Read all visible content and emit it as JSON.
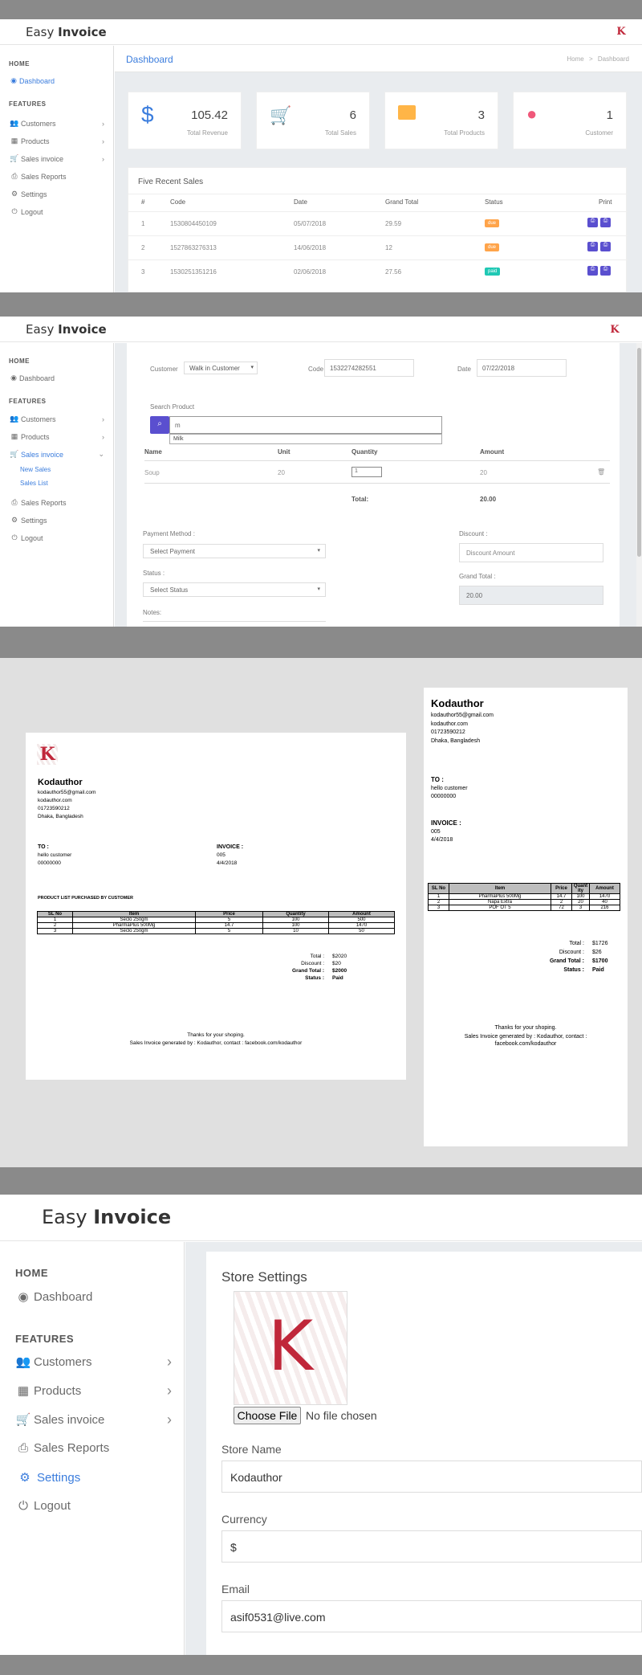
{
  "app": {
    "logo_plain": "Easy ",
    "logo_bold": "Invoice",
    "avatar_letter": "K"
  },
  "sidebar": {
    "home_heading": "HOME",
    "features_heading": "FEATURES",
    "items": [
      {
        "label": "Dashboard",
        "icon": "dashboard-icon"
      },
      {
        "label": "Customers",
        "icon": "customers-icon"
      },
      {
        "label": "Products",
        "icon": "products-icon"
      },
      {
        "label": "Sales invoice",
        "icon": "cart-icon"
      },
      {
        "label": "Sales Reports",
        "icon": "printer-icon"
      },
      {
        "label": "Settings",
        "icon": "gear-icon"
      },
      {
        "label": "Logout",
        "icon": "power-icon"
      }
    ],
    "sub_items": [
      "New Sales",
      "Sales List"
    ]
  },
  "dashboard": {
    "title": "Dashboard",
    "breadcrumb_home": "Home",
    "breadcrumb_sep": ">",
    "breadcrumb_current": "Dashboard",
    "stats": [
      {
        "value": "105.42",
        "label": "Total Revenue",
        "icon": "$",
        "color": "#3b7ddd"
      },
      {
        "value": "6",
        "label": "Total Sales",
        "icon": "cart",
        "color": "#1fc8b4"
      },
      {
        "value": "3",
        "label": "Total Products",
        "icon": "box",
        "color": "#ffb547"
      },
      {
        "value": "1",
        "label": "Customer",
        "icon": "user",
        "color": "#f0587a"
      }
    ],
    "recent_title": "Five Recent Sales",
    "columns": [
      "#",
      "Code",
      "Date",
      "Grand Total",
      "Status",
      "Print"
    ],
    "rows": [
      {
        "n": "1",
        "code": "1530804450109",
        "date": "05/07/2018",
        "total": "29.59",
        "status": "due",
        "color": "#ffa44a"
      },
      {
        "n": "2",
        "code": "1527863276313",
        "date": "14/06/2018",
        "total": "12",
        "status": "due",
        "color": "#ffa44a"
      },
      {
        "n": "3",
        "code": "1530251351216",
        "date": "02/06/2018",
        "total": "27.56",
        "status": "paid",
        "color": "#1fc8b4"
      }
    ]
  },
  "new_sale": {
    "customer_label": "Customer",
    "customer_value": "Walk in Customer",
    "code_label": "Code",
    "code_value": "1532274282551",
    "date_label": "Date",
    "date_value": "07/22/2018",
    "search_label": "Search Product",
    "search_value": "m",
    "suggestion": "Milk",
    "columns": [
      "Name",
      "Unit",
      "Quantity",
      "Amount"
    ],
    "item": {
      "name": "Soup",
      "unit": "20",
      "qty": "1",
      "amount": "20"
    },
    "total_label": "Total:",
    "total_value": "20.00",
    "payment_label": "Payment Method :",
    "payment_placeholder": "Select Payment",
    "status_label": "Status :",
    "status_placeholder": "Select Status",
    "notes_label": "Notes:",
    "discount_label": "Discount :",
    "discount_placeholder": "Discount Amount",
    "grand_label": "Grand Total :",
    "grand_value": "20.00"
  },
  "invoice_a4": {
    "company": "Kodauthor",
    "email": "kodauthor55@gmail.com",
    "site": "kodauthor.com",
    "phone": "01723590212",
    "address": "Dhaka, Bangladesh",
    "to_label": "TO :",
    "to_name": "hello customer",
    "to_phone": "00000000",
    "invoice_label": "INVOICE :",
    "invoice_no": "005",
    "invoice_date": "4/4/2018",
    "list_title": "PRODUCT LIST PURCHASED BY CUSTOMER",
    "columns": [
      "SL No",
      "Item",
      "Price",
      "Quantity",
      "Amount"
    ],
    "rows": [
      [
        "1",
        "Seclo 250gm",
        "5",
        "100",
        "500"
      ],
      [
        "2",
        "PharmaPlus 500Mg",
        "14.7",
        "100",
        "1470"
      ],
      [
        "3",
        "Seclo 250gm",
        "5",
        "10",
        "50"
      ]
    ],
    "total_label": "Total :",
    "total_value": "$2020",
    "discount_label": "Discount :",
    "discount_value": "$20",
    "grand_label": "Grand Total :",
    "grand_value": "$2000",
    "status_label": "Status :",
    "status_value": "Paid",
    "thanks": "Thanks for your shoping.",
    "footer": "Sales Invoice generated by : Kodauthor, contact : facebook.com/kodauthor"
  },
  "invoice_pos": {
    "company": "Kodauthor",
    "email": "kodauthor55@gmail.com",
    "site": "kodauthor.com",
    "phone": "01723590212",
    "address": "Dhaka, Bangladesh",
    "to_label": "TO :",
    "to_name": "hello customer",
    "to_phone": "00000000",
    "invoice_label": "INVOICE :",
    "invoice_no": "005",
    "invoice_date": "4/4/2018",
    "columns": [
      "SL No",
      "Item",
      "Price",
      "Quant ity",
      "Amount"
    ],
    "rows": [
      [
        "1",
        "PharmaPlus 500Mg",
        "14.7",
        "100",
        "1470"
      ],
      [
        "2",
        "Napa Extra",
        "2",
        "20",
        "40"
      ],
      [
        "3",
        "POF OT 5",
        "72",
        "3",
        "216"
      ]
    ],
    "total_label": "Total :",
    "total_value": "$1726",
    "discount_label": "Discount :",
    "discount_value": "$26",
    "grand_label": "Grand Total :",
    "grand_value": "$1700",
    "status_label": "Status :",
    "status_value": "Paid",
    "thanks": "Thanks for your shoping.",
    "footer1": "Sales Invoice generated by : Kodauthor, contact :",
    "footer2": "facebook.com/kodauthor"
  },
  "settings": {
    "title": "Store Settings",
    "choose_file": "Choose File",
    "no_file": "No file chosen",
    "store_label": "Store Name",
    "store_value": "Kodauthor",
    "currency_label": "Currency",
    "currency_value": "$",
    "email_label": "Email",
    "email_value": "asif0531@live.com"
  }
}
